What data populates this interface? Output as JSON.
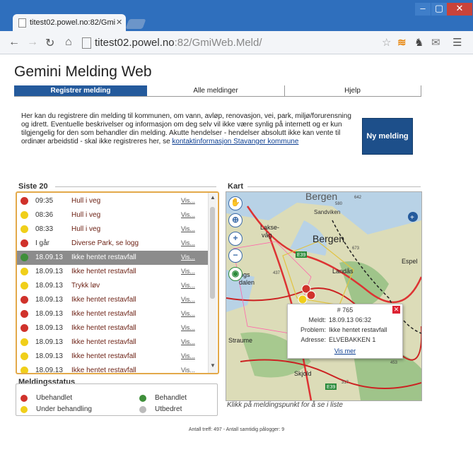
{
  "browser": {
    "tab_title": "titest02.powel.no:82/Gmi",
    "url_host": "titest02.powel.no",
    "url_rest": ":82/GmiWeb.Meld/"
  },
  "app": {
    "title": "Gemini Melding Web",
    "tabs": [
      {
        "label": "Registrer melding",
        "active": true
      },
      {
        "label": "Alle meldinger",
        "active": false
      },
      {
        "label": "Hjelp",
        "active": false
      }
    ],
    "intro_text": "Her kan du registrere din melding til kommunen, om vann, avløp, renovasjon, vei, park, miljø/forurensning og idrett. Eventuelle beskrivelser og informasjon om deg selv vil ikke være synlig på internett og er kun tilgjengelig for den som behandler din melding. Akutte hendelser - hendelser absolutt ikke kan vente til ordinær arbeidstid - skal ikke registreres her, se ",
    "intro_link": "kontaktinformasjon Stavanger kommune",
    "new_button": "Ny melding"
  },
  "list": {
    "title": "Siste 20",
    "vis_label": "Vis...",
    "rows": [
      {
        "time": "09:35",
        "kind": "Hull i veg",
        "status": "red"
      },
      {
        "time": "08:36",
        "kind": "Hull i veg",
        "status": "yellow"
      },
      {
        "time": "08:33",
        "kind": "Hull i veg",
        "status": "yellow"
      },
      {
        "time": "I går",
        "kind": "Diverse Park, se logg",
        "status": "red"
      },
      {
        "time": "18.09.13",
        "kind": "Ikke hentet restavfall",
        "status": "green",
        "selected": true
      },
      {
        "time": "18.09.13",
        "kind": "Ikke hentet restavfall",
        "status": "yellow"
      },
      {
        "time": "18.09.13",
        "kind": "Trykk løv",
        "status": "yellow"
      },
      {
        "time": "18.09.13",
        "kind": "Ikke hentet restavfall",
        "status": "red"
      },
      {
        "time": "18.09.13",
        "kind": "Ikke hentet restavfall",
        "status": "red"
      },
      {
        "time": "18.09.13",
        "kind": "Ikke hentet restavfall",
        "status": "red"
      },
      {
        "time": "18.09.13",
        "kind": "Ikke hentet restavfall",
        "status": "yellow"
      },
      {
        "time": "18.09.13",
        "kind": "Ikke hentet restavfall",
        "status": "yellow"
      },
      {
        "time": "18.09.13",
        "kind": "Ikke hentet restavfall",
        "status": "yellow"
      }
    ]
  },
  "map": {
    "title": "Kart",
    "place_labels": [
      "Bergen",
      "Sandviken",
      "Bergen",
      "Lakse-",
      "våg",
      "Fyllings",
      "dalen",
      "Landås",
      "Espel",
      "Straume",
      "Skjold"
    ],
    "road_labels": [
      "E39",
      "E39",
      "580",
      "642",
      "437",
      "673",
      "453",
      "317"
    ],
    "popup": {
      "id": "# 765",
      "meldt_label": "Meldt:",
      "meldt_value": "18.09.13 06:32",
      "problem_label": "Problem:",
      "problem_value": "Ikke hentet restavfall",
      "adresse_label": "Adresse:",
      "adresse_value": "ELVEBAKKEN 1",
      "vis_mer": "Vis mer"
    },
    "hint": "Klikk på meldingspunkt for å se i liste"
  },
  "legend": {
    "title": "Meldingsstatus",
    "items": [
      {
        "label": "Ubehandlet",
        "color": "#d0322b"
      },
      {
        "label": "Behandlet",
        "color": "#3f8f3a"
      },
      {
        "label": "Under behandling",
        "color": "#f0cf1a"
      },
      {
        "label": "Utbedret",
        "color": "#bbbbbb"
      }
    ]
  },
  "footer": "Antall treff: 497 - Antall samtidig pålogger: 9",
  "colors": {
    "red": "#d0322b",
    "yellow": "#f0cf1a",
    "green": "#3f8f3a",
    "grey": "#bbbbbb",
    "accent": "#245a9c"
  }
}
